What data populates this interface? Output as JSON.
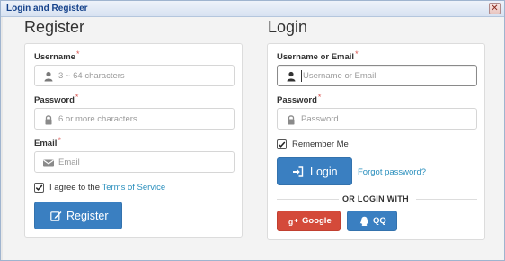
{
  "window": {
    "title": "Login and Register",
    "close_glyph": "✕"
  },
  "register": {
    "heading": "Register",
    "username": {
      "label": "Username",
      "required": "*",
      "placeholder": "3 ~ 64 characters",
      "icon": "user-icon"
    },
    "password": {
      "label": "Password",
      "required": "*",
      "placeholder": "6 or more characters",
      "icon": "lock-icon"
    },
    "email": {
      "label": "Email",
      "required": "*",
      "placeholder": "Email",
      "icon": "envelope-icon"
    },
    "agree": {
      "text": "I agree to the",
      "link": "Terms of Service",
      "checked": true
    },
    "submit": {
      "label": "Register",
      "icon": "edit-icon"
    }
  },
  "login": {
    "heading": "Login",
    "username": {
      "label": "Username or Email",
      "required": "*",
      "placeholder": "Username or Email",
      "icon": "user-icon"
    },
    "password": {
      "label": "Password",
      "required": "*",
      "placeholder": "Password",
      "icon": "lock-icon"
    },
    "remember": {
      "text": "Remember Me",
      "checked": true
    },
    "submit": {
      "label": "Login",
      "icon": "sign-in-icon"
    },
    "forgot": "Forgot password?",
    "divider": "OR LOGIN WITH",
    "social": [
      {
        "label": "Google",
        "icon": "google-plus-icon",
        "color": "#d44a3a"
      },
      {
        "label": "QQ",
        "icon": "qq-icon",
        "color": "#3a7fc1"
      }
    ]
  },
  "colors": {
    "primary": "#3a7fc1",
    "google": "#d44a3a",
    "link": "#2a8fbd",
    "required": "#d9534f"
  }
}
